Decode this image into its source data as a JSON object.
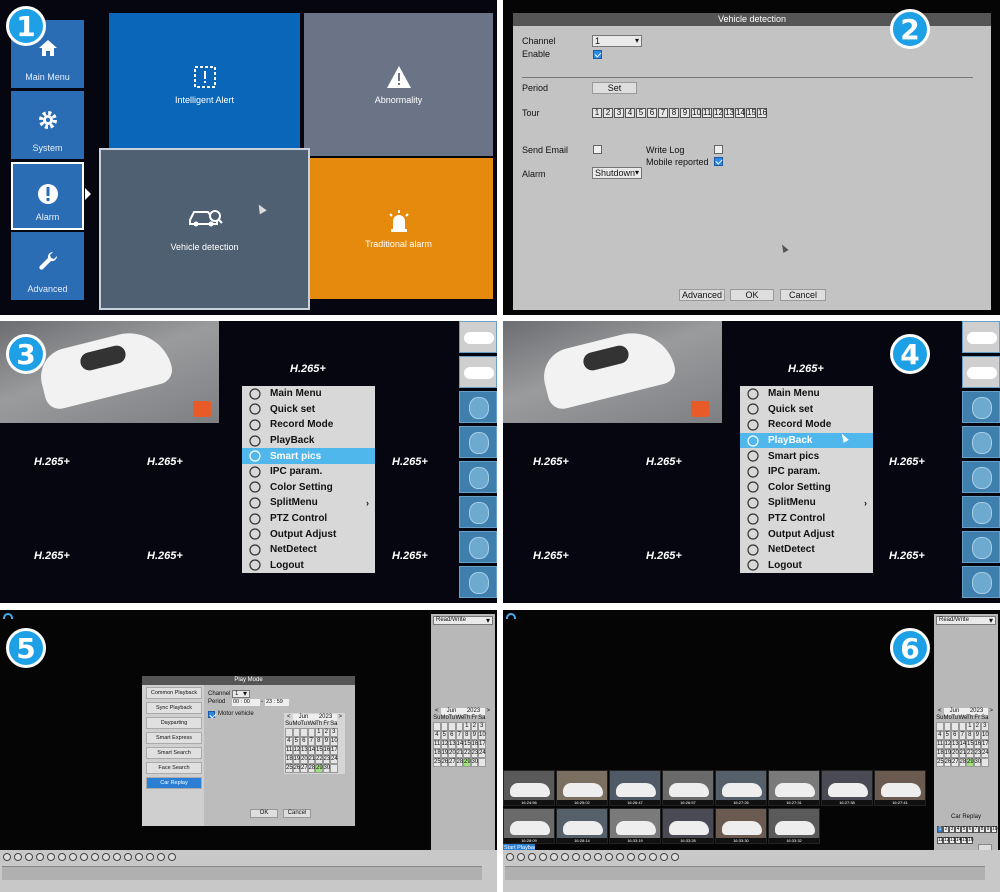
{
  "steps": [
    "1",
    "2",
    "3",
    "4",
    "5",
    "6"
  ],
  "panel1": {
    "sidebar": [
      {
        "label": "Main Menu",
        "icon": "home-icon"
      },
      {
        "label": "System",
        "icon": "gear-icon"
      },
      {
        "label": "Alarm",
        "icon": "alert-circle-icon"
      },
      {
        "label": "Advanced",
        "icon": "wrench-icon"
      }
    ],
    "tiles": {
      "intelligent_alert": "Intelligent Alert",
      "abnormality": "Abnormality",
      "vehicle_detection": "Vehicle detection",
      "traditional_alarm": "Traditional alarm"
    },
    "colors": {
      "blue": "#0a66b8",
      "gray": "#6b7486",
      "orange": "#e58a0c",
      "slate": "#4f6073"
    }
  },
  "panel2": {
    "title": "Vehicle detection",
    "channel_label": "Channel",
    "channel_value": "1",
    "enable_label": "Enable",
    "period_label": "Period",
    "set_button": "Set",
    "tour_label": "Tour",
    "tour_numbers": [
      "1",
      "2",
      "3",
      "4",
      "5",
      "6",
      "7",
      "8",
      "9",
      "10",
      "11",
      "12",
      "13",
      "14",
      "15",
      "16"
    ],
    "send_email_label": "Send Email",
    "write_log_label": "Write Log",
    "mobile_reported_label": "Mobile reported",
    "alarm_label": "Alarm",
    "alarm_value": "Shutdown",
    "advanced_button": "Advanced",
    "ok_button": "OK",
    "cancel_button": "Cancel"
  },
  "panel3": {
    "codec": "H.265+",
    "menu": [
      "Main Menu",
      "Quick set",
      "Record Mode",
      "PlayBack",
      "Smart pics",
      "IPC param.",
      "Color Setting",
      "SplitMenu",
      "PTZ Control",
      "Output Adjust",
      "NetDetect",
      "Logout"
    ],
    "highlighted": 4
  },
  "panel4": {
    "codec": "H.265+",
    "menu": [
      "Main Menu",
      "Quick set",
      "Record Mode",
      "PlayBack",
      "Smart pics",
      "IPC param.",
      "Color Setting",
      "SplitMenu",
      "PTZ Control",
      "Output Adjust",
      "NetDetect",
      "Logout"
    ],
    "highlighted": 3
  },
  "panel5": {
    "read_write": "Read/Write",
    "calendar": {
      "month": "Jun",
      "year": "2023",
      "weekdays": [
        "Su",
        "Mo",
        "Tu",
        "We",
        "Th",
        "Fr",
        "Sa"
      ],
      "weeks": [
        [
          "",
          "",
          "",
          "",
          "1",
          "2",
          "3"
        ],
        [
          "4",
          "5",
          "6",
          "7",
          "8",
          "9",
          "10"
        ],
        [
          "11",
          "12",
          "13",
          "14",
          "15",
          "16",
          "17"
        ],
        [
          "18",
          "19",
          "20",
          "21",
          "22",
          "23",
          "24"
        ],
        [
          "25",
          "26",
          "27",
          "28",
          "29",
          "30",
          ""
        ]
      ]
    },
    "play_mode": {
      "title": "Play Mode",
      "modes": [
        "Common Playback",
        "Sync Playback",
        "Dayparting",
        "Smart Express",
        "Smart Search",
        "Face Search",
        "Car Replay"
      ],
      "selected": 6,
      "channel_label": "Channel",
      "channel_value": "1",
      "period_label": "Period",
      "period_from": "00 : 00",
      "period_to": "23 : 59",
      "motor_vehicle": "Motor vehicle",
      "ok": "OK",
      "cancel": "Cancel"
    }
  },
  "panel6": {
    "read_write": "Read/Write",
    "car_replay": "Car Replay",
    "start_playback": "Start Playback",
    "channels": [
      "1",
      "2",
      "3",
      "4",
      "5",
      "6",
      "7",
      "8",
      "9",
      "10",
      "11",
      "12",
      "13",
      "14",
      "15",
      "16"
    ],
    "times_row1": [
      "16:24:56",
      "16:25:02",
      "16:26:47",
      "16:26:57",
      "16:27:26",
      "16:27:31",
      "16:27:38",
      "16:27:41"
    ],
    "times_row2": [
      "16:28:09",
      "16:28:14",
      "16:33:19",
      "16:33:28",
      "16:33:30",
      "16:33:32"
    ]
  }
}
